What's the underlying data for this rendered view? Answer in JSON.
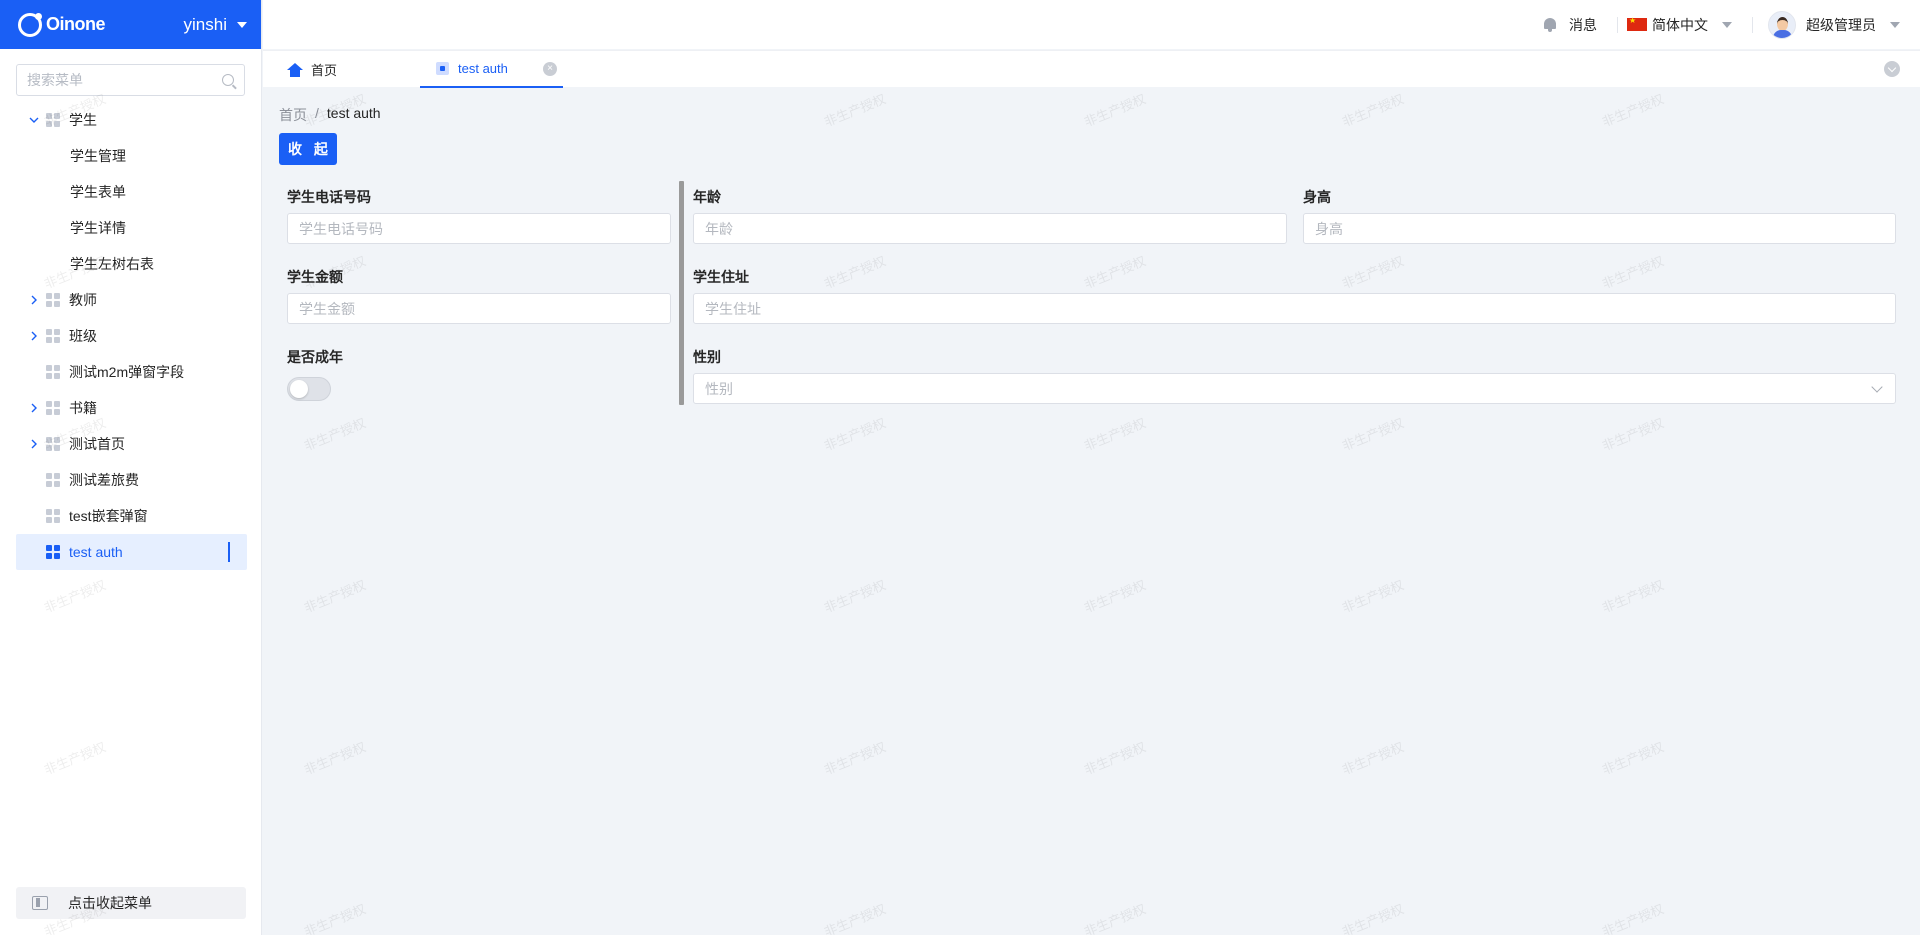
{
  "brand": {
    "name": "Oinone",
    "tenant": "yinshi"
  },
  "sidebar": {
    "search_placeholder": "搜索菜单",
    "items": [
      {
        "label": "学生"
      },
      {
        "label": "学生管理"
      },
      {
        "label": "学生表单"
      },
      {
        "label": "学生详情"
      },
      {
        "label": "学生左树右表"
      },
      {
        "label": "教师"
      },
      {
        "label": "班级"
      },
      {
        "label": "测试m2m弹窗字段"
      },
      {
        "label": "书籍"
      },
      {
        "label": "测试首页"
      },
      {
        "label": "测试差旅费"
      },
      {
        "label": "test嵌套弹窗"
      },
      {
        "label": "test auth"
      }
    ],
    "collapse_label": "点击收起菜单"
  },
  "header": {
    "messages": "消息",
    "language": "简体中文",
    "user": "超级管理员"
  },
  "tabs": [
    {
      "label": "首页"
    },
    {
      "label": "test auth"
    }
  ],
  "breadcrumb": {
    "home": "首页",
    "separator": "/",
    "current": "test auth"
  },
  "actions": {
    "collapse": "收 起"
  },
  "form": {
    "phone": {
      "label": "学生电话号码",
      "placeholder": "学生电话号码"
    },
    "age": {
      "label": "年龄",
      "placeholder": "年龄"
    },
    "height": {
      "label": "身高",
      "placeholder": "身高"
    },
    "amount": {
      "label": "学生金额",
      "placeholder": "学生金额"
    },
    "address": {
      "label": "学生住址",
      "placeholder": "学生住址"
    },
    "adult": {
      "label": "是否成年",
      "value": false
    },
    "gender": {
      "label": "性别",
      "placeholder": "性别"
    }
  },
  "watermark": "非生产授权",
  "colors": {
    "primary": "#1a5ff5",
    "background": "#f1f4f8"
  }
}
